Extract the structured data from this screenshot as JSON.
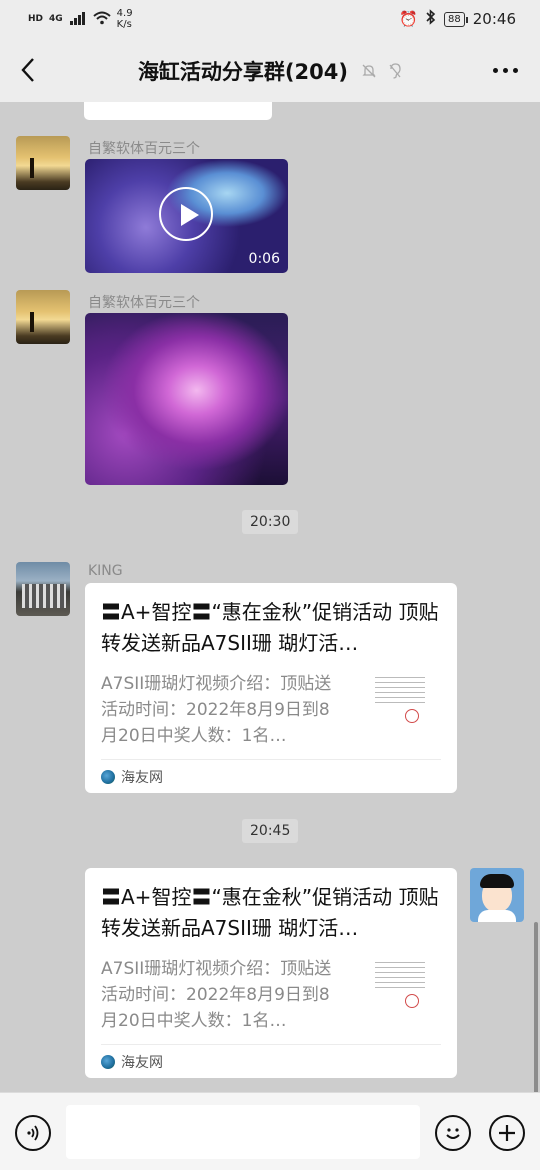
{
  "status_bar": {
    "network_label": "HD",
    "signal_label": "4G",
    "speed": "4.9",
    "speed_unit": "K/s",
    "battery": "88",
    "time": "20:46"
  },
  "header": {
    "title": "海缸活动分享群(204)",
    "back_icon": "chevron-left-icon",
    "more_icon": "more-dots-icon"
  },
  "messages": [
    {
      "sender": "自繁软体百元三个",
      "type": "video",
      "duration": "0:06"
    },
    {
      "sender": "自繁软体百元三个",
      "type": "image"
    },
    {
      "type": "time",
      "text": "20:30"
    },
    {
      "sender": "KING",
      "type": "link",
      "title": "〓A+智控〓“惠在金秋”促销活动 顶贴转发送新品A7SII珊 瑚灯活…",
      "description": "A7SII珊瑚灯视频介绍：顶贴送活动时间：2022年8月9日到8月20日中奖人数：1名…",
      "source": "海友网"
    },
    {
      "type": "time",
      "text": "20:45"
    },
    {
      "sender": "",
      "type": "link",
      "title": "〓A+智控〓“惠在金秋”促销活动 顶贴转发送新品A7SII珊 瑚灯活…",
      "description": "A7SII珊瑚灯视频介绍：顶贴送活动时间：2022年8月9日到8月20日中奖人数：1名…",
      "source": "海友网"
    }
  ],
  "input_bar": {
    "voice_icon": "voice-icon",
    "emoji_icon": "emoji-icon",
    "plus_icon": "plus-icon",
    "placeholder": ""
  }
}
